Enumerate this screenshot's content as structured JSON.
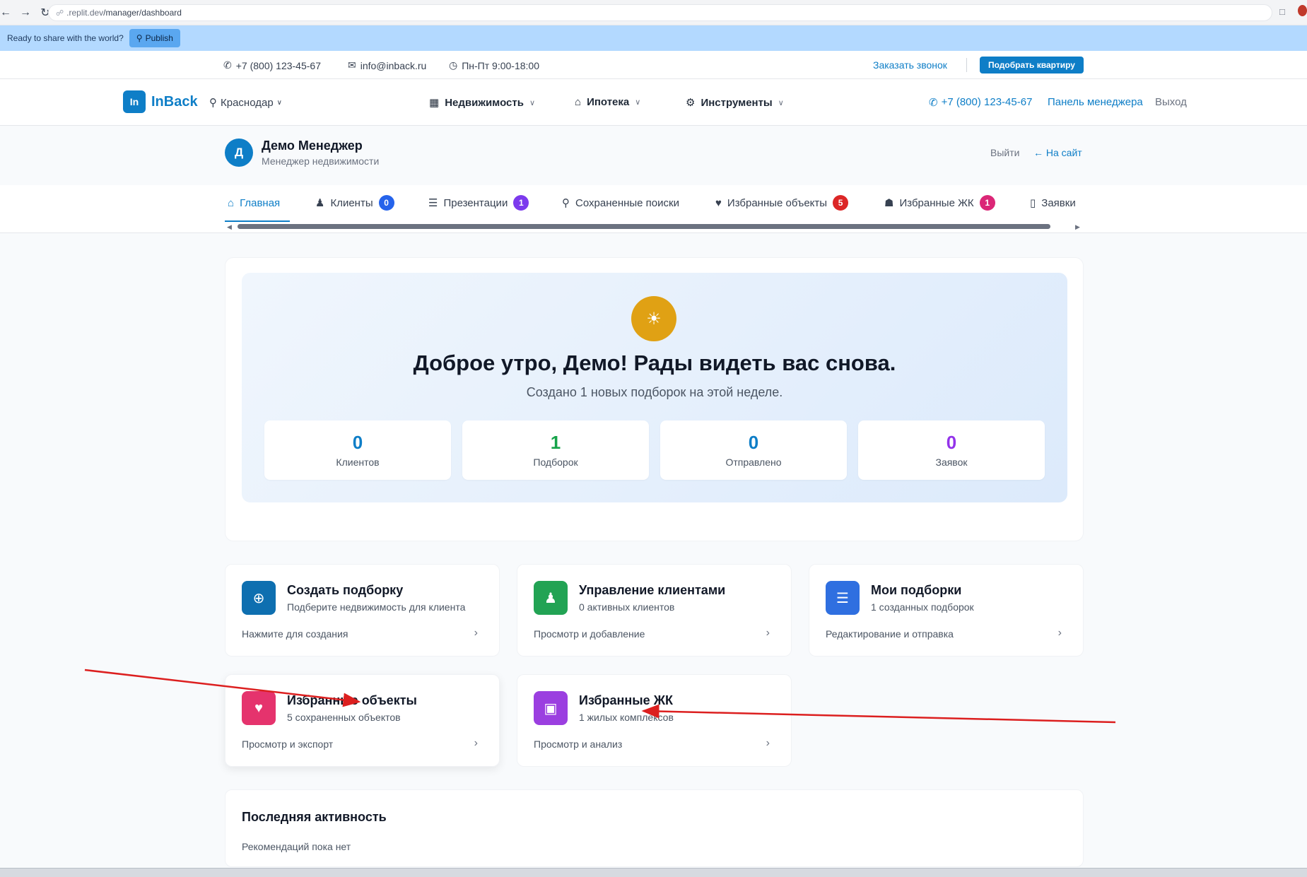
{
  "browser": {
    "url_prefix": ".replit.dev",
    "url_path": "/manager/dashboard"
  },
  "replit": {
    "message": "Ready to share with the world?",
    "publish_label": "Publish"
  },
  "topbar": {
    "phone": "+7 (800) 123-45-67",
    "email": "info@inback.ru",
    "hours": "Пн-Пт 9:00-18:00",
    "callback_label": "Заказать звонок",
    "pick_label": "Подобрать квартиру"
  },
  "header": {
    "logo_mark": "In",
    "logo_text": "InBack",
    "city": "Краснодар",
    "nav": [
      {
        "label": "Недвижимость",
        "icon": "building-icon"
      },
      {
        "label": "Ипотека",
        "icon": "home-icon"
      },
      {
        "label": "Инструменты",
        "icon": "gear-icon"
      }
    ],
    "phone": "+7 (800) 123-45-67",
    "panel_label": "Панель менеджера",
    "logout_label": "Выход"
  },
  "profile": {
    "initial": "Д",
    "name": "Демо Менеджер",
    "role": "Менеджер недвижимости",
    "exit_label": "Выйти",
    "site_label": "На сайт"
  },
  "tabs": [
    {
      "label": "Главная",
      "icon": "home-icon",
      "active": true
    },
    {
      "label": "Клиенты",
      "icon": "users-icon",
      "badge": "0",
      "badge_color": "#2563eb"
    },
    {
      "label": "Презентации",
      "icon": "presentation-icon",
      "badge": "1",
      "badge_color": "#7c3aed"
    },
    {
      "label": "Сохраненные поиски",
      "icon": "search-icon"
    },
    {
      "label": "Избранные объекты",
      "icon": "heart-icon",
      "badge": "5",
      "badge_color": "#dc2626"
    },
    {
      "label": "Избранные ЖК",
      "icon": "building-complex-icon",
      "badge": "1",
      "badge_color": "#db2777"
    },
    {
      "label": "Заявки",
      "icon": "phone-icon"
    }
  ],
  "greeting": {
    "title": "Доброе утро, Демо! Рады видеть вас снова.",
    "subtitle": "Создано 1 новых подборок на этой неделе.",
    "stats": [
      {
        "value": "0",
        "label": "Клиентов",
        "color": "#0e7ec7"
      },
      {
        "value": "1",
        "label": "Подборок",
        "color": "#16a34a"
      },
      {
        "value": "0",
        "label": "Отправлено",
        "color": "#0e7ec7"
      },
      {
        "value": "0",
        "label": "Заявок",
        "color": "#9333ea"
      }
    ]
  },
  "cards": [
    {
      "title": "Создать подборку",
      "subtitle": "Подберите недвижимость для клиента",
      "footer": "Нажмите для создания",
      "icon": "plus-circle-icon",
      "color": "#0e6fb0"
    },
    {
      "title": "Управление клиентами",
      "subtitle": "0 активных клиентов",
      "footer": "Просмотр и добавление",
      "icon": "users-icon",
      "color": "#22a354"
    },
    {
      "title": "Мои подборки",
      "subtitle": "1 созданных подборок",
      "footer": "Редактирование и отправка",
      "icon": "list-icon",
      "color": "#2f6fe0"
    },
    {
      "title": "Избранные объекты",
      "subtitle": "5 сохраненных объектов",
      "footer": "Просмотр и экспорт",
      "icon": "heart-icon",
      "color": "#e5336d"
    },
    {
      "title": "Избранные ЖК",
      "subtitle": "1 жилых комплексов",
      "footer": "Просмотр и анализ",
      "icon": "image-icon",
      "color": "#9b3fe0"
    }
  ],
  "activity": {
    "title": "Последняя активность",
    "empty": "Рекомендаций пока нет"
  },
  "annotation_color": "#dc1f1f"
}
